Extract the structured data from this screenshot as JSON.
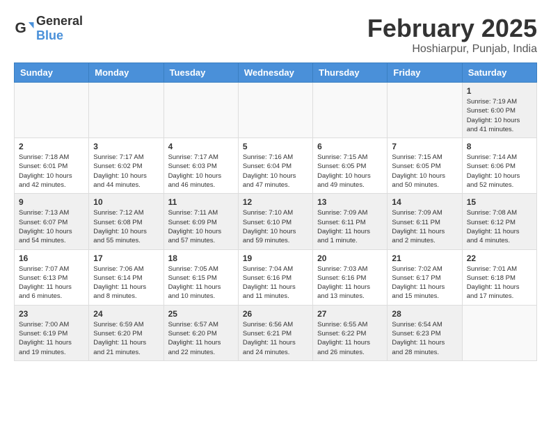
{
  "header": {
    "logo_general": "General",
    "logo_blue": "Blue",
    "month": "February 2025",
    "location": "Hoshiarpur, Punjab, India"
  },
  "weekdays": [
    "Sunday",
    "Monday",
    "Tuesday",
    "Wednesday",
    "Thursday",
    "Friday",
    "Saturday"
  ],
  "weeks": [
    [
      {
        "day": "",
        "info": ""
      },
      {
        "day": "",
        "info": ""
      },
      {
        "day": "",
        "info": ""
      },
      {
        "day": "",
        "info": ""
      },
      {
        "day": "",
        "info": ""
      },
      {
        "day": "",
        "info": ""
      },
      {
        "day": "1",
        "info": "Sunrise: 7:19 AM\nSunset: 6:00 PM\nDaylight: 10 hours\nand 41 minutes."
      }
    ],
    [
      {
        "day": "2",
        "info": "Sunrise: 7:18 AM\nSunset: 6:01 PM\nDaylight: 10 hours\nand 42 minutes."
      },
      {
        "day": "3",
        "info": "Sunrise: 7:17 AM\nSunset: 6:02 PM\nDaylight: 10 hours\nand 44 minutes."
      },
      {
        "day": "4",
        "info": "Sunrise: 7:17 AM\nSunset: 6:03 PM\nDaylight: 10 hours\nand 46 minutes."
      },
      {
        "day": "5",
        "info": "Sunrise: 7:16 AM\nSunset: 6:04 PM\nDaylight: 10 hours\nand 47 minutes."
      },
      {
        "day": "6",
        "info": "Sunrise: 7:15 AM\nSunset: 6:05 PM\nDaylight: 10 hours\nand 49 minutes."
      },
      {
        "day": "7",
        "info": "Sunrise: 7:15 AM\nSunset: 6:05 PM\nDaylight: 10 hours\nand 50 minutes."
      },
      {
        "day": "8",
        "info": "Sunrise: 7:14 AM\nSunset: 6:06 PM\nDaylight: 10 hours\nand 52 minutes."
      }
    ],
    [
      {
        "day": "9",
        "info": "Sunrise: 7:13 AM\nSunset: 6:07 PM\nDaylight: 10 hours\nand 54 minutes."
      },
      {
        "day": "10",
        "info": "Sunrise: 7:12 AM\nSunset: 6:08 PM\nDaylight: 10 hours\nand 55 minutes."
      },
      {
        "day": "11",
        "info": "Sunrise: 7:11 AM\nSunset: 6:09 PM\nDaylight: 10 hours\nand 57 minutes."
      },
      {
        "day": "12",
        "info": "Sunrise: 7:10 AM\nSunset: 6:10 PM\nDaylight: 10 hours\nand 59 minutes."
      },
      {
        "day": "13",
        "info": "Sunrise: 7:09 AM\nSunset: 6:11 PM\nDaylight: 11 hours\nand 1 minute."
      },
      {
        "day": "14",
        "info": "Sunrise: 7:09 AM\nSunset: 6:11 PM\nDaylight: 11 hours\nand 2 minutes."
      },
      {
        "day": "15",
        "info": "Sunrise: 7:08 AM\nSunset: 6:12 PM\nDaylight: 11 hours\nand 4 minutes."
      }
    ],
    [
      {
        "day": "16",
        "info": "Sunrise: 7:07 AM\nSunset: 6:13 PM\nDaylight: 11 hours\nand 6 minutes."
      },
      {
        "day": "17",
        "info": "Sunrise: 7:06 AM\nSunset: 6:14 PM\nDaylight: 11 hours\nand 8 minutes."
      },
      {
        "day": "18",
        "info": "Sunrise: 7:05 AM\nSunset: 6:15 PM\nDaylight: 11 hours\nand 10 minutes."
      },
      {
        "day": "19",
        "info": "Sunrise: 7:04 AM\nSunset: 6:16 PM\nDaylight: 11 hours\nand 11 minutes."
      },
      {
        "day": "20",
        "info": "Sunrise: 7:03 AM\nSunset: 6:16 PM\nDaylight: 11 hours\nand 13 minutes."
      },
      {
        "day": "21",
        "info": "Sunrise: 7:02 AM\nSunset: 6:17 PM\nDaylight: 11 hours\nand 15 minutes."
      },
      {
        "day": "22",
        "info": "Sunrise: 7:01 AM\nSunset: 6:18 PM\nDaylight: 11 hours\nand 17 minutes."
      }
    ],
    [
      {
        "day": "23",
        "info": "Sunrise: 7:00 AM\nSunset: 6:19 PM\nDaylight: 11 hours\nand 19 minutes."
      },
      {
        "day": "24",
        "info": "Sunrise: 6:59 AM\nSunset: 6:20 PM\nDaylight: 11 hours\nand 21 minutes."
      },
      {
        "day": "25",
        "info": "Sunrise: 6:57 AM\nSunset: 6:20 PM\nDaylight: 11 hours\nand 22 minutes."
      },
      {
        "day": "26",
        "info": "Sunrise: 6:56 AM\nSunset: 6:21 PM\nDaylight: 11 hours\nand 24 minutes."
      },
      {
        "day": "27",
        "info": "Sunrise: 6:55 AM\nSunset: 6:22 PM\nDaylight: 11 hours\nand 26 minutes."
      },
      {
        "day": "28",
        "info": "Sunrise: 6:54 AM\nSunset: 6:23 PM\nDaylight: 11 hours\nand 28 minutes."
      },
      {
        "day": "",
        "info": ""
      }
    ]
  ]
}
